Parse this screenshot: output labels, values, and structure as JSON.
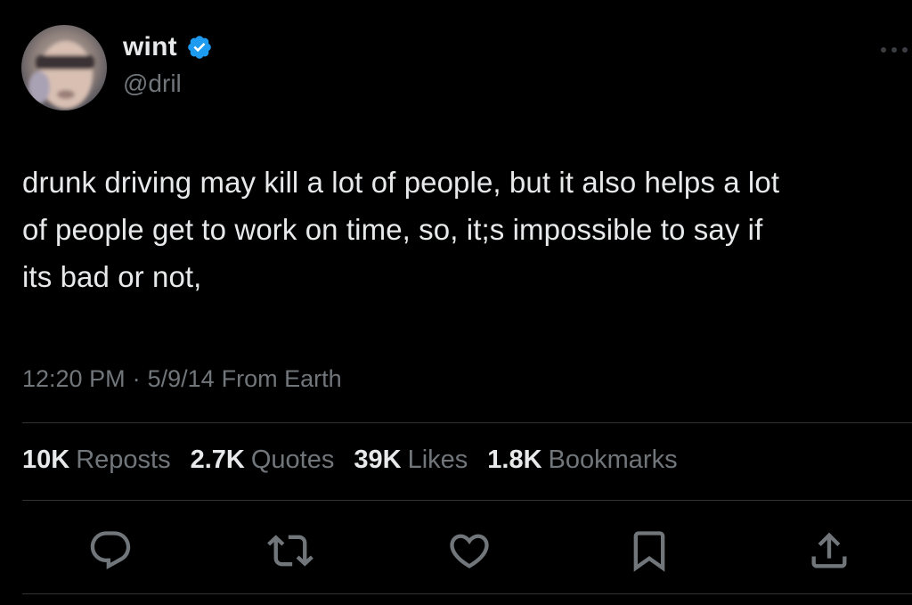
{
  "author": {
    "display_name": "wint",
    "handle": "@dril",
    "verified_color": "#1d9bf0"
  },
  "tweet": {
    "text": "drunk driving may kill a lot of people, but it also helps a lot\nof people get to work on time, so, it;s impossible to say if\nits bad or not,",
    "time": "12:20 PM",
    "separator": "·",
    "date": "5/9/14",
    "source": "From Earth"
  },
  "stats": [
    {
      "count": "10K",
      "label": "Reposts"
    },
    {
      "count": "2.7K",
      "label": "Quotes"
    },
    {
      "count": "39K",
      "label": "Likes"
    },
    {
      "count": "1.8K",
      "label": "Bookmarks"
    }
  ],
  "actions": [
    "reply-icon",
    "repost-icon",
    "like-icon",
    "bookmark-icon",
    "share-icon"
  ],
  "colors": {
    "background": "#000000",
    "text_primary": "#e7e9ea",
    "text_secondary": "#71767b",
    "divider": "#2f3336"
  }
}
